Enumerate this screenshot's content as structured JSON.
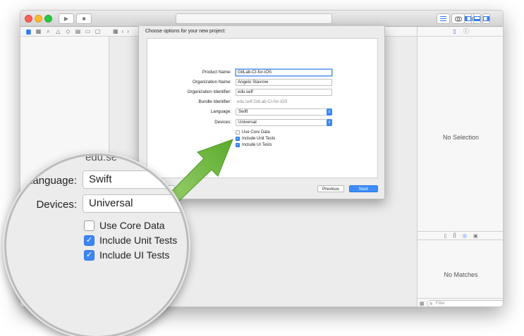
{
  "sheet": {
    "title": "Choose options for your new project:",
    "fields": {
      "product_name": {
        "label": "Product Name:",
        "value": "GitLab-CI-for-iOS"
      },
      "organization_name": {
        "label": "Organization Name:",
        "value": "Angelo Stavrow"
      },
      "organization_identifier": {
        "label": "Organization Identifier:",
        "value": "edu.self"
      },
      "bundle_identifier": {
        "label": "Bundle Identifier:",
        "value": "edu.self.GitLab-CI-for-iOS"
      },
      "language": {
        "label": "Language:",
        "value": "Swift"
      },
      "devices": {
        "label": "Devices:",
        "value": "Universal"
      }
    },
    "checkboxes": [
      {
        "label": "Use Core Data",
        "checked": false
      },
      {
        "label": "Include Unit Tests",
        "checked": true
      },
      {
        "label": "Include UI Tests",
        "checked": true
      }
    ],
    "buttons": {
      "cancel": "ncel",
      "previous": "Previous",
      "next": "Next"
    }
  },
  "inspector": {
    "no_selection": "No Selection",
    "no_matches": "No Matches",
    "filter_placeholder": "Filter"
  },
  "zoom": {
    "top_fragment": "edu.se",
    "language_label": "Language:",
    "language_value": "Swift",
    "devices_label": "Devices:",
    "devices_value": "Universal",
    "checkboxes": [
      {
        "label": "Use Core Data",
        "checked": false
      },
      {
        "label": "Include Unit Tests",
        "checked": true
      },
      {
        "label": "Include UI Tests",
        "checked": true
      }
    ]
  },
  "icons": {
    "checkmark": "✓",
    "play": "▶",
    "stop": "■",
    "chevron_left": "‹",
    "chevron_right": "›",
    "popup": "⇕"
  },
  "colors": {
    "accent": "#3c86f5",
    "arrow": "#72c043"
  }
}
